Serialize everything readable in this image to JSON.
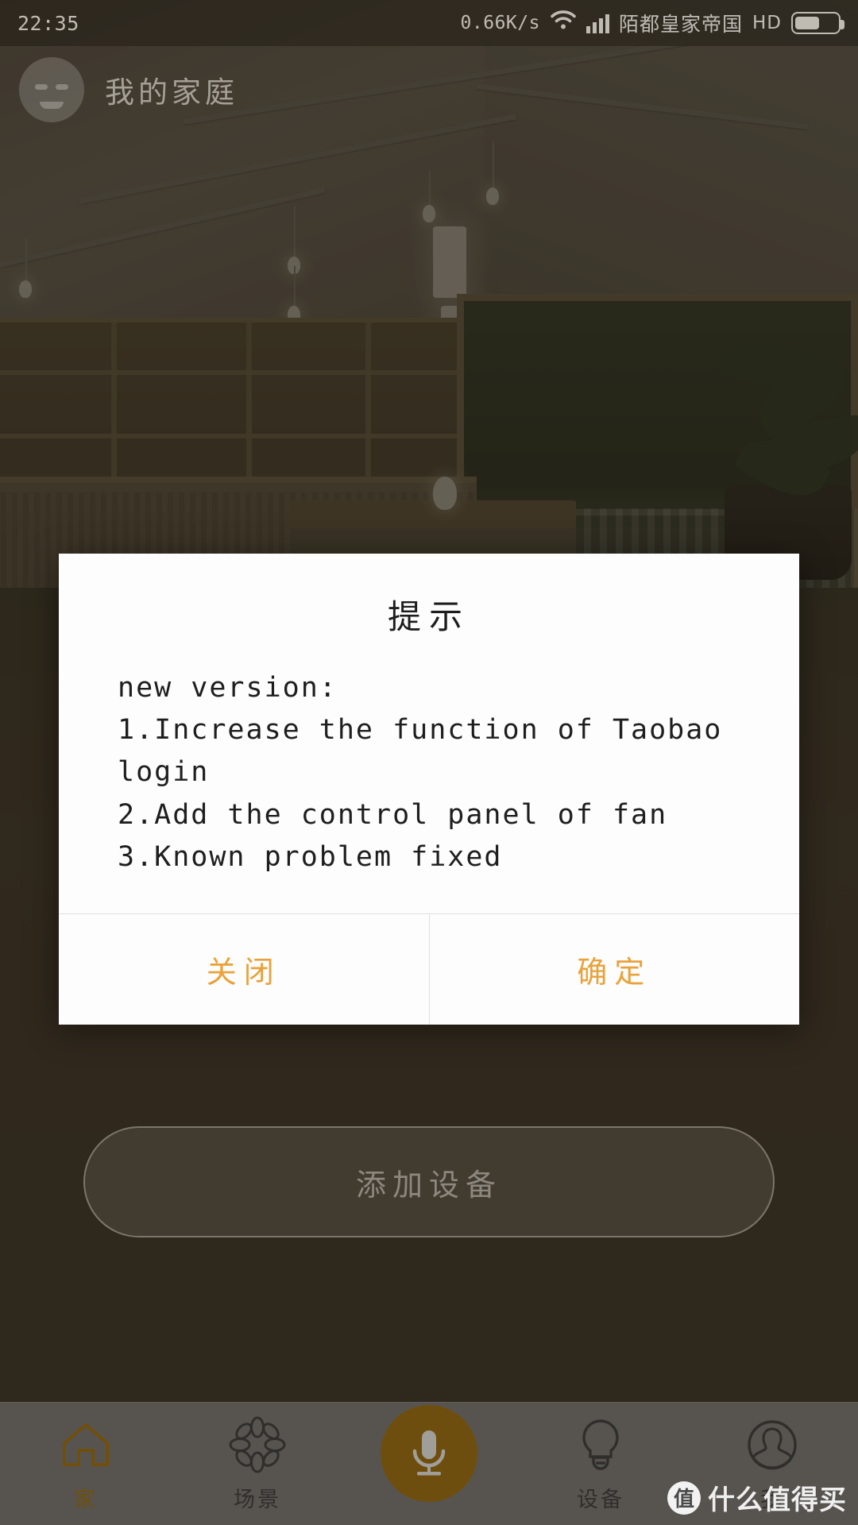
{
  "status_bar": {
    "time": "22:35",
    "net_speed": "0.66K/s",
    "wifi_icon": "wifi-icon",
    "signal_icon": "cellular-signal-icon",
    "carrier": "陌都皇家帝国",
    "hd": "HD",
    "battery_icon": "battery-icon"
  },
  "header": {
    "avatar_icon": "user-avatar-icon",
    "home_name": "我的家庭"
  },
  "main": {
    "add_device_label": "添加设备"
  },
  "dialog": {
    "title": "提示",
    "lines": [
      "new version:",
      "1.Increase the function of Taobao login",
      "2.Add the control panel of fan",
      "3.Known problem fixed"
    ],
    "body_text": "new version:\n1.Increase the function of Taobao\nlogin\n2.Add the control panel of fan\n3.Known problem fixed",
    "close_label": "关闭",
    "confirm_label": "确定",
    "accent_color": "#e9a23b"
  },
  "tabbar": {
    "items": [
      {
        "label": "家",
        "icon": "home-icon",
        "active": true
      },
      {
        "label": "场景",
        "icon": "scene-flower-icon",
        "active": false
      },
      {
        "label": "",
        "icon": "microphone-icon",
        "active": false
      },
      {
        "label": "设备",
        "icon": "lightbulb-icon",
        "active": false
      },
      {
        "label": "我",
        "icon": "profile-person-icon",
        "active": false
      }
    ],
    "active_color": "#8c6310",
    "inactive_color": "#3c3a36",
    "mic_button_color": "#8a6212"
  },
  "watermark": {
    "badge": "值",
    "text": "什么值得买"
  }
}
